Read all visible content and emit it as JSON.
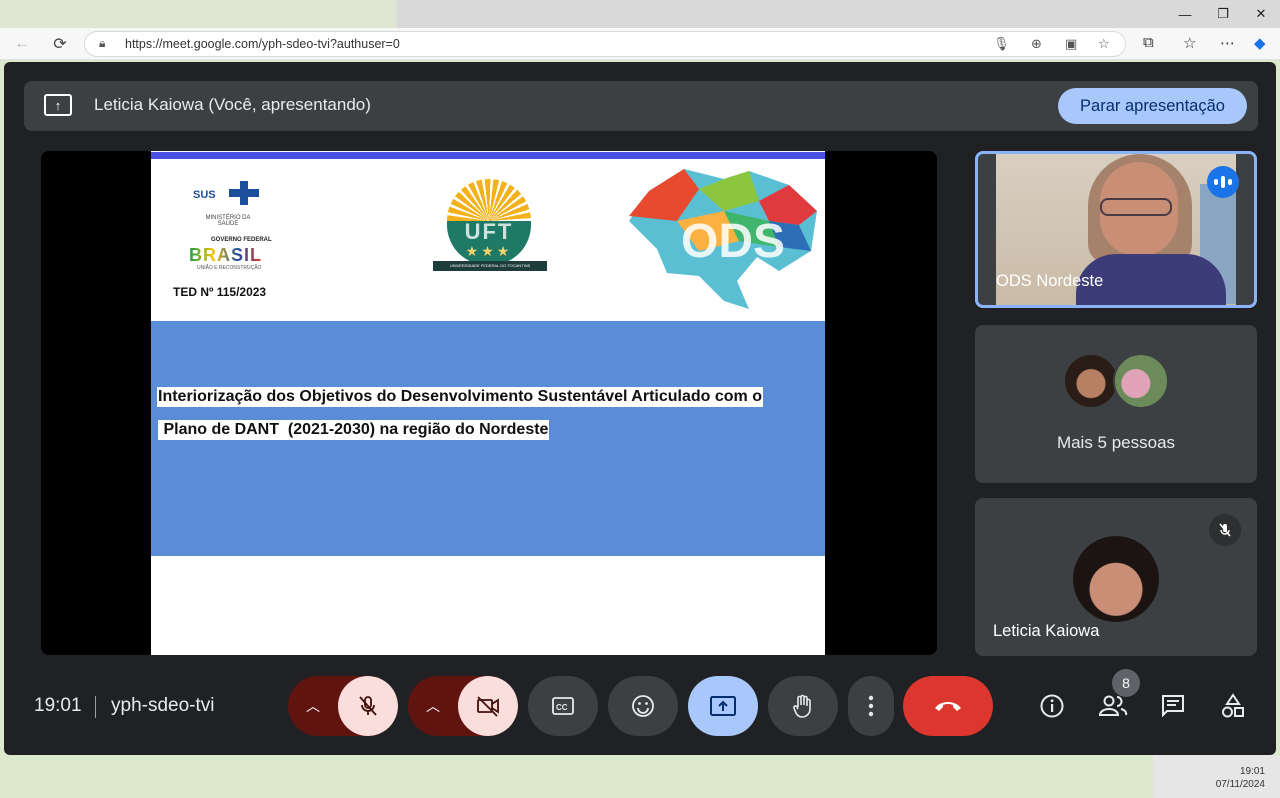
{
  "browser": {
    "url": "https://meet.google.com/yph-sdeo-tvi?authuser=0",
    "minimize_icon": "minimize-icon",
    "maximize_icon": "maximize-icon",
    "close_icon": "close-icon"
  },
  "presenting_bar": {
    "text": "Leticia Kaiowa (Você, apresentando)",
    "stop_label": "Parar apresentação"
  },
  "slide": {
    "ted": "TED Nº 115/2023",
    "line1": "Interiorização dos Objetivos do Desenvolvimento Sustentável Articulado com o",
    "line2": " Plano de DANT  (2021-2030) na região do Nordeste",
    "logo_sus": "SUS",
    "logo_ministerio": "MINISTÉRIO DA SAÚDE",
    "logo_governo": "GOVERNO FEDERAL",
    "logo_brasil": "BRASIL",
    "logo_uniao": "UNIÃO E RECONSTRUÇÃO",
    "logo_uft": "UFT",
    "logo_uft_ribbon": "UNIVERSIDADE FEDERAL DO TOCANTINS",
    "logo_ods": "ODS"
  },
  "participants": {
    "tile1_name": "ODS Nordeste",
    "tile2_label": "Mais 5 pessoas",
    "tile3_name": "Leticia Kaiowa"
  },
  "controls": {
    "time": "19:01",
    "meeting_code": "yph-sdeo-tvi",
    "people_count": "8"
  },
  "taskbar": {
    "time": "19:01",
    "date": "07/11/2024"
  },
  "colors": {
    "meet_bg": "#202124",
    "tile_bg": "#3c4043",
    "accent_blue": "#a8c7fa",
    "end_call_red": "#dc362e",
    "mute_red_dark": "#601410",
    "mute_pink": "#f9dedc",
    "slide_blue": "#5b8dd6"
  }
}
